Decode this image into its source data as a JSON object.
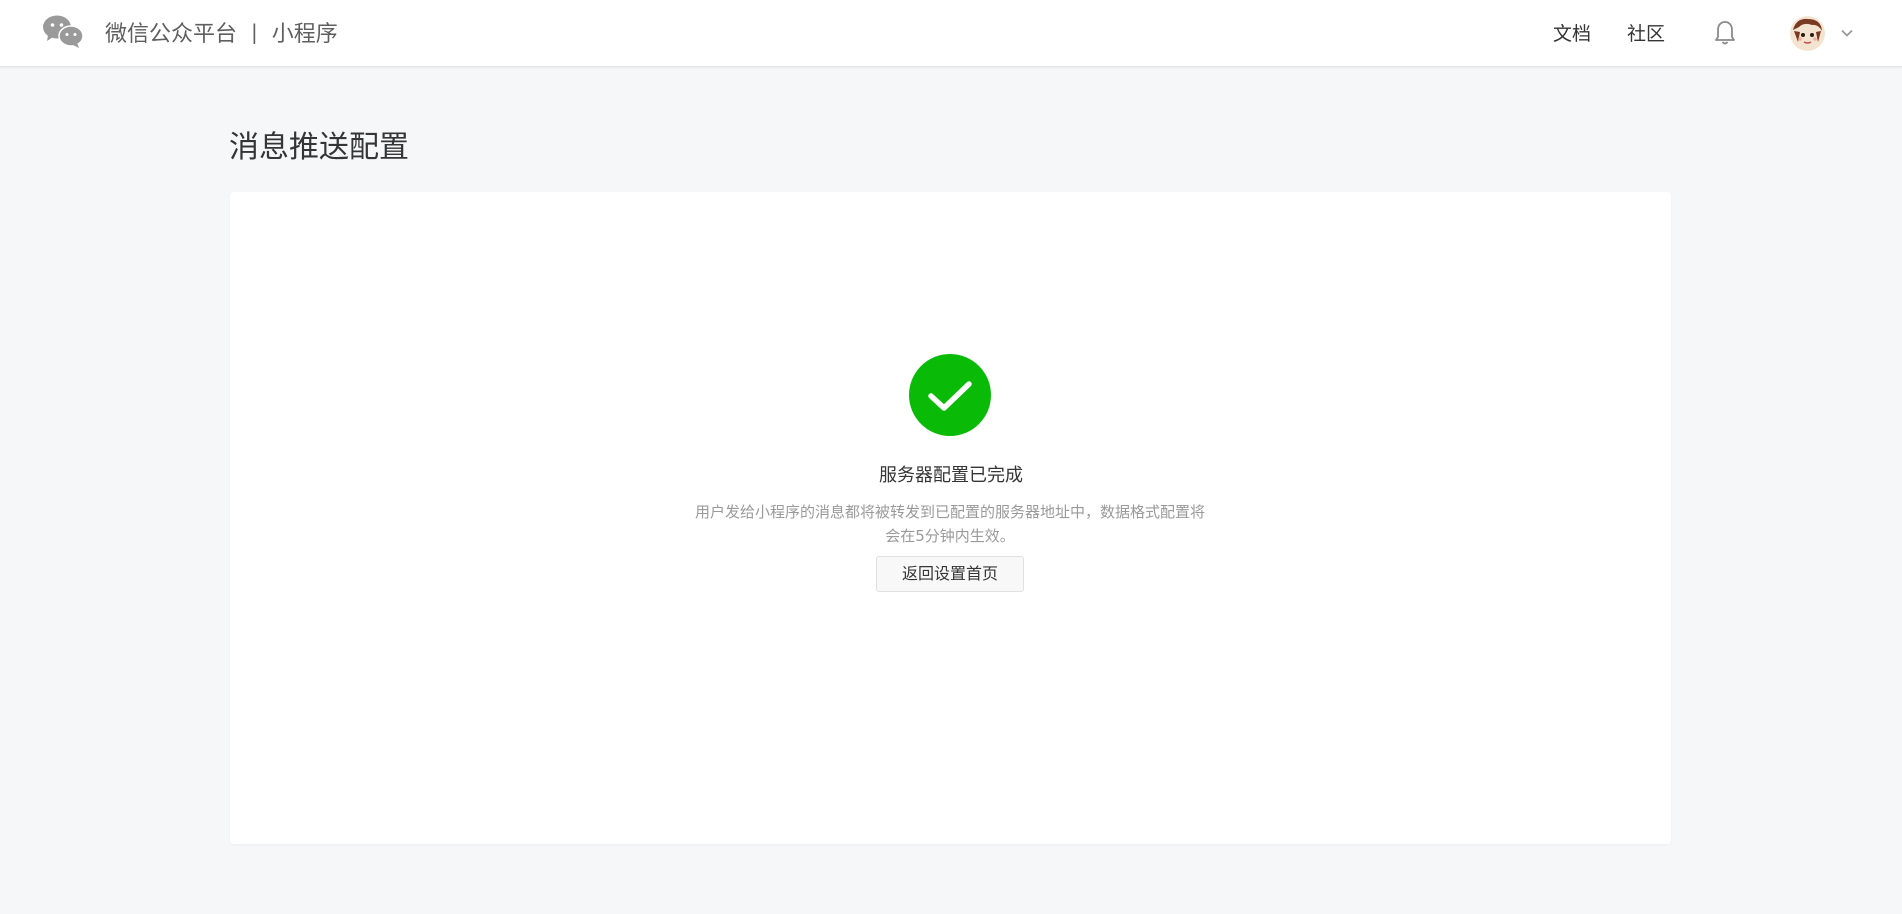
{
  "header": {
    "brand_name": "微信公众平台",
    "separator": "|",
    "product_name": "小程序",
    "nav_docs": "文档",
    "nav_community": "社区",
    "logo_icon": "wechat-logo-icon",
    "notification_icon": "bell-icon",
    "menu_icon": "chevron-down-icon"
  },
  "page": {
    "title": "消息推送配置"
  },
  "result": {
    "icon": "check-circle-icon",
    "icon_color": "#09bb07",
    "title": "服务器配置已完成",
    "description": "用户发给小程序的消息都将被转发到已配置的服务器地址中，数据格式配置将会在5分钟内生效。",
    "back_button_label": "返回设置首页"
  }
}
